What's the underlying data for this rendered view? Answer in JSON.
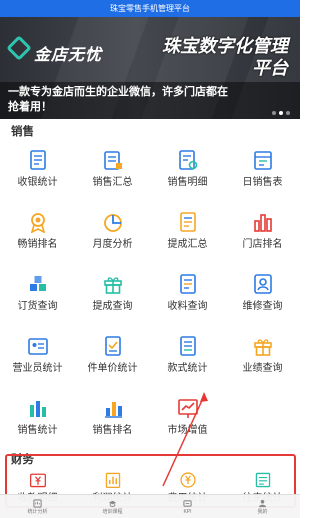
{
  "app": {
    "title": "珠宝零售手机管理平台"
  },
  "banner": {
    "logo_text": "金店无忧",
    "slogan": "珠宝数字化管理平台",
    "caption_line1": "一款专为金店而生的企业微信，许多门店都在",
    "caption_line2": "抢着用！"
  },
  "sales": {
    "title": "销售",
    "items": [
      {
        "label": "收银统计",
        "icon": "register-icon",
        "color": "#2d7be5"
      },
      {
        "label": "销售汇总",
        "icon": "summary-doc-icon",
        "color": "#2d7be5"
      },
      {
        "label": "销售明细",
        "icon": "detail-doc-icon",
        "color": "#2d7be5"
      },
      {
        "label": "日销售表",
        "icon": "daily-sheet-icon",
        "color": "#2d7be5"
      },
      {
        "label": "畅销排名",
        "icon": "medal-icon",
        "color": "#f5a623"
      },
      {
        "label": "月度分析",
        "icon": "pie-chart-icon",
        "color": "#f5a623"
      },
      {
        "label": "提成汇总",
        "icon": "commission-doc-icon",
        "color": "#f5a623"
      },
      {
        "label": "门店排名",
        "icon": "bar-rank-icon",
        "color": "#e53935"
      },
      {
        "label": "订货查询",
        "icon": "cubes-icon",
        "color": "#2d7be5"
      },
      {
        "label": "提成查询",
        "icon": "gift-icon",
        "color": "#26bfa5"
      },
      {
        "label": "收料查询",
        "icon": "receive-doc-icon",
        "color": "#2d7be5"
      },
      {
        "label": "维修查询",
        "icon": "repair-icon",
        "color": "#2d7be5"
      },
      {
        "label": "营业员统计",
        "icon": "staff-card-icon",
        "color": "#2d7be5"
      },
      {
        "label": "件单价统计",
        "icon": "price-doc-icon",
        "color": "#2d7be5"
      },
      {
        "label": "款式统计",
        "icon": "style-doc-icon",
        "color": "#2d7be5"
      },
      {
        "label": "业绩查询",
        "icon": "performance-gift-icon",
        "color": "#f5a623"
      },
      {
        "label": "销售统计",
        "icon": "sales-bars-icon",
        "color": "#26bfa5"
      },
      {
        "label": "销售排名",
        "icon": "sales-rank-icon",
        "color": "#2d7be5"
      },
      {
        "label": "市场增值",
        "icon": "market-growth-icon",
        "color": "#e53935"
      }
    ]
  },
  "finance": {
    "title": "财务",
    "items": [
      {
        "label": "收款明细",
        "icon": "yen-card-icon",
        "color": "#e53935"
      },
      {
        "label": "利润统计",
        "icon": "profit-bars-icon",
        "color": "#f5a623"
      },
      {
        "label": "费用统计",
        "icon": "yen-coin-icon",
        "color": "#f5a623"
      },
      {
        "label": "往来统计",
        "icon": "ledger-icon",
        "color": "#26bfa5"
      }
    ]
  },
  "tabbar": {
    "items": [
      {
        "label": "统计分析",
        "icon": "stats-tab-icon"
      },
      {
        "label": "培训课程",
        "icon": "course-tab-icon"
      },
      {
        "label": "KPI",
        "icon": "kpi-tab-icon"
      },
      {
        "label": "我的",
        "icon": "profile-tab-icon"
      }
    ]
  }
}
